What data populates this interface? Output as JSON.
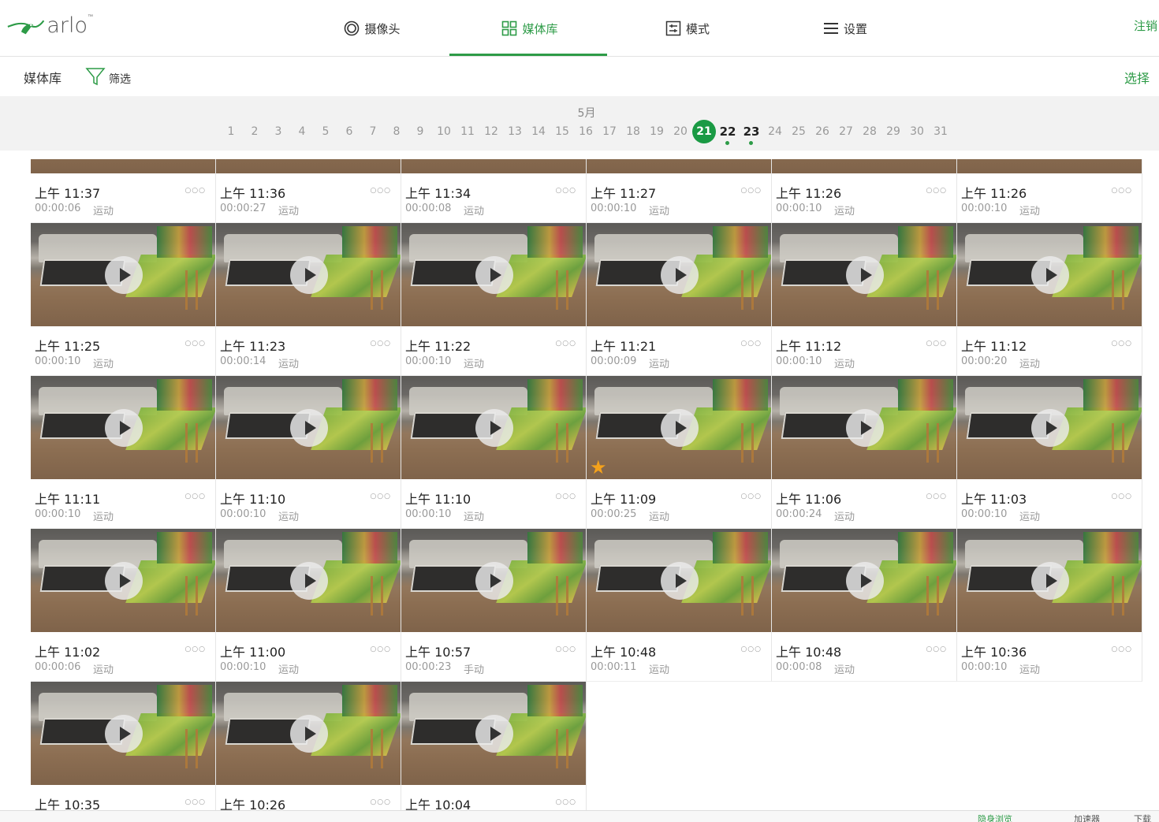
{
  "brand": {
    "logo_text": "arlo",
    "trademark": "™",
    "color": "#2d9b47"
  },
  "nav": {
    "items": [
      {
        "label": "摄像头",
        "icon": "camera-icon",
        "active": false
      },
      {
        "label": "媒体库",
        "icon": "grid-icon",
        "active": true
      },
      {
        "label": "模式",
        "icon": "mode-sliders-icon",
        "active": false
      },
      {
        "label": "设置",
        "icon": "menu-icon",
        "active": false
      }
    ],
    "logout": "注销"
  },
  "subbar": {
    "title": "媒体库",
    "filter_label": "筛选",
    "select_label": "选择"
  },
  "calendar": {
    "month": "5月",
    "days": [
      "1",
      "2",
      "3",
      "4",
      "5",
      "6",
      "7",
      "8",
      "9",
      "10",
      "11",
      "12",
      "13",
      "14",
      "15",
      "16",
      "17",
      "18",
      "19",
      "20",
      "21",
      "22",
      "23",
      "24",
      "25",
      "26",
      "27",
      "28",
      "29",
      "30",
      "31"
    ],
    "selected_day": "21",
    "days_with_media": [
      "22",
      "23"
    ]
  },
  "clips": [
    {
      "time": "上午 11:37",
      "duration": "00:00:06",
      "trigger": "运动",
      "starred": false
    },
    {
      "time": "上午 11:36",
      "duration": "00:00:27",
      "trigger": "运动",
      "starred": false
    },
    {
      "time": "上午 11:34",
      "duration": "00:00:08",
      "trigger": "运动",
      "starred": false
    },
    {
      "time": "上午 11:27",
      "duration": "00:00:10",
      "trigger": "运动",
      "starred": false
    },
    {
      "time": "上午 11:26",
      "duration": "00:00:10",
      "trigger": "运动",
      "starred": false
    },
    {
      "time": "上午 11:26",
      "duration": "00:00:10",
      "trigger": "运动",
      "starred": false
    },
    {
      "time": "上午 11:25",
      "duration": "00:00:10",
      "trigger": "运动",
      "starred": false
    },
    {
      "time": "上午 11:23",
      "duration": "00:00:14",
      "trigger": "运动",
      "starred": false
    },
    {
      "time": "上午 11:22",
      "duration": "00:00:10",
      "trigger": "运动",
      "starred": false
    },
    {
      "time": "上午 11:21",
      "duration": "00:00:09",
      "trigger": "运动",
      "starred": false
    },
    {
      "time": "上午 11:12",
      "duration": "00:00:10",
      "trigger": "运动",
      "starred": false
    },
    {
      "time": "上午 11:12",
      "duration": "00:00:20",
      "trigger": "运动",
      "starred": false
    },
    {
      "time": "上午 11:11",
      "duration": "00:00:10",
      "trigger": "运动",
      "starred": false
    },
    {
      "time": "上午 11:10",
      "duration": "00:00:10",
      "trigger": "运动",
      "starred": false
    },
    {
      "time": "上午 11:10",
      "duration": "00:00:10",
      "trigger": "运动",
      "starred": false
    },
    {
      "time": "上午 11:09",
      "duration": "00:00:25",
      "trigger": "运动",
      "starred": true
    },
    {
      "time": "上午 11:06",
      "duration": "00:00:24",
      "trigger": "运动",
      "starred": false
    },
    {
      "time": "上午 11:03",
      "duration": "00:00:10",
      "trigger": "运动",
      "starred": false
    },
    {
      "time": "上午 11:02",
      "duration": "00:00:06",
      "trigger": "运动",
      "starred": false
    },
    {
      "time": "上午 11:00",
      "duration": "00:00:10",
      "trigger": "运动",
      "starred": false
    },
    {
      "time": "上午 10:57",
      "duration": "00:00:23",
      "trigger": "手动",
      "starred": false
    },
    {
      "time": "上午 10:48",
      "duration": "00:00:11",
      "trigger": "运动",
      "starred": false
    },
    {
      "time": "上午 10:48",
      "duration": "00:00:08",
      "trigger": "运动",
      "starred": false
    },
    {
      "time": "上午 10:36",
      "duration": "00:00:10",
      "trigger": "运动",
      "starred": false
    },
    {
      "time": "上午 10:35",
      "duration": "",
      "trigger": "",
      "starred": false
    },
    {
      "time": "上午 10:26",
      "duration": "",
      "trigger": "",
      "starred": false
    },
    {
      "time": "上午 10:04",
      "duration": "",
      "trigger": "",
      "starred": false
    }
  ],
  "more_glyph": "○○○",
  "star_glyph": "★",
  "statusbar": {
    "items": [
      "隐身浏览",
      "加速器",
      "下载"
    ]
  }
}
